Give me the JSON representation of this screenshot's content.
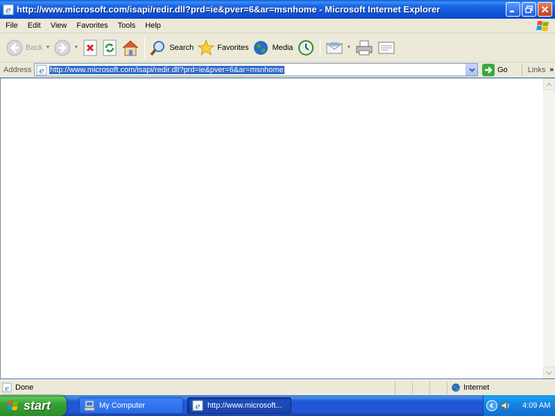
{
  "window": {
    "title": "http://www.microsoft.com/isapi/redir.dll?prd=ie&pver=6&ar=msnhome - Microsoft Internet Explorer"
  },
  "menu": [
    "File",
    "Edit",
    "View",
    "Favorites",
    "Tools",
    "Help"
  ],
  "toolbar": {
    "back_label": "Back",
    "search_label": "Search",
    "favorites_label": "Favorites",
    "media_label": "Media"
  },
  "address": {
    "label": "Address",
    "url": "http://www.microsoft.com/isapi/redir.dll?prd=ie&pver=6&ar=msnhome",
    "go_label": "Go",
    "links_label": "Links"
  },
  "status": {
    "text": "Done",
    "zone": "Internet"
  },
  "taskbar": {
    "start_label": "start",
    "tasks": [
      {
        "label": "My Computer",
        "active": false
      },
      {
        "label": "http://www.microsoft...",
        "active": true
      }
    ],
    "clock": "4:09 AM"
  },
  "colors": {
    "titlebar": "#0a48c8",
    "chrome": "#ece9d8",
    "selection": "#316ac5",
    "taskbar": "#2157d7",
    "start_button": "#36a234"
  }
}
